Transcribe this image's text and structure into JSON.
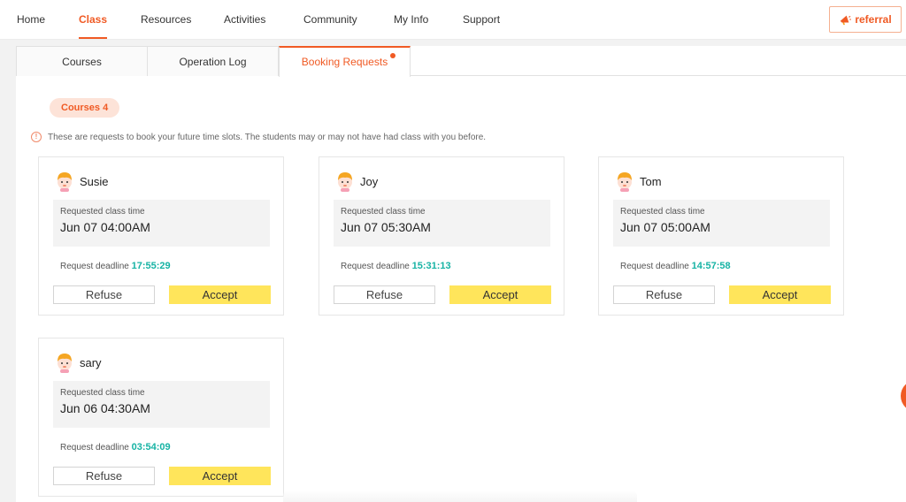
{
  "nav": {
    "items": [
      {
        "label": "Home",
        "active": false
      },
      {
        "label": "Class",
        "active": true
      },
      {
        "label": "Resources",
        "active": false
      },
      {
        "label": "Activities",
        "active": false
      },
      {
        "label": "Community",
        "active": false
      },
      {
        "label": "My Info",
        "active": false
      },
      {
        "label": "Support",
        "active": false
      }
    ],
    "referral_label": "referral"
  },
  "tabs": [
    {
      "label": "Courses",
      "active": false,
      "dot": false
    },
    {
      "label": "Operation Log",
      "active": false,
      "dot": false
    },
    {
      "label": "Booking Requests",
      "active": true,
      "dot": true
    }
  ],
  "badge": "Courses 4",
  "info_text": "These are requests to book your future time slots. The students may or may not have had class with you before.",
  "labels": {
    "requested_time": "Requested class time",
    "deadline": "Request deadline",
    "refuse": "Refuse",
    "accept": "Accept"
  },
  "requests": [
    {
      "name": "Susie",
      "time": "Jun 07 04:00AM",
      "countdown": "17:55:29"
    },
    {
      "name": "Joy",
      "time": "Jun 07 05:30AM",
      "countdown": "15:31:13"
    },
    {
      "name": "Tom",
      "time": "Jun 07 05:00AM",
      "countdown": "14:57:58"
    },
    {
      "name": "sary",
      "time": "Jun 06 04:30AM",
      "countdown": "03:54:09"
    }
  ],
  "colors": {
    "accent": "#f05a24",
    "accept": "#ffe55b",
    "countdown": "#16b3a4"
  },
  "icons": {
    "avatar": "student-avatar-icon",
    "info": "info-icon",
    "referral": "megaphone-icon"
  }
}
